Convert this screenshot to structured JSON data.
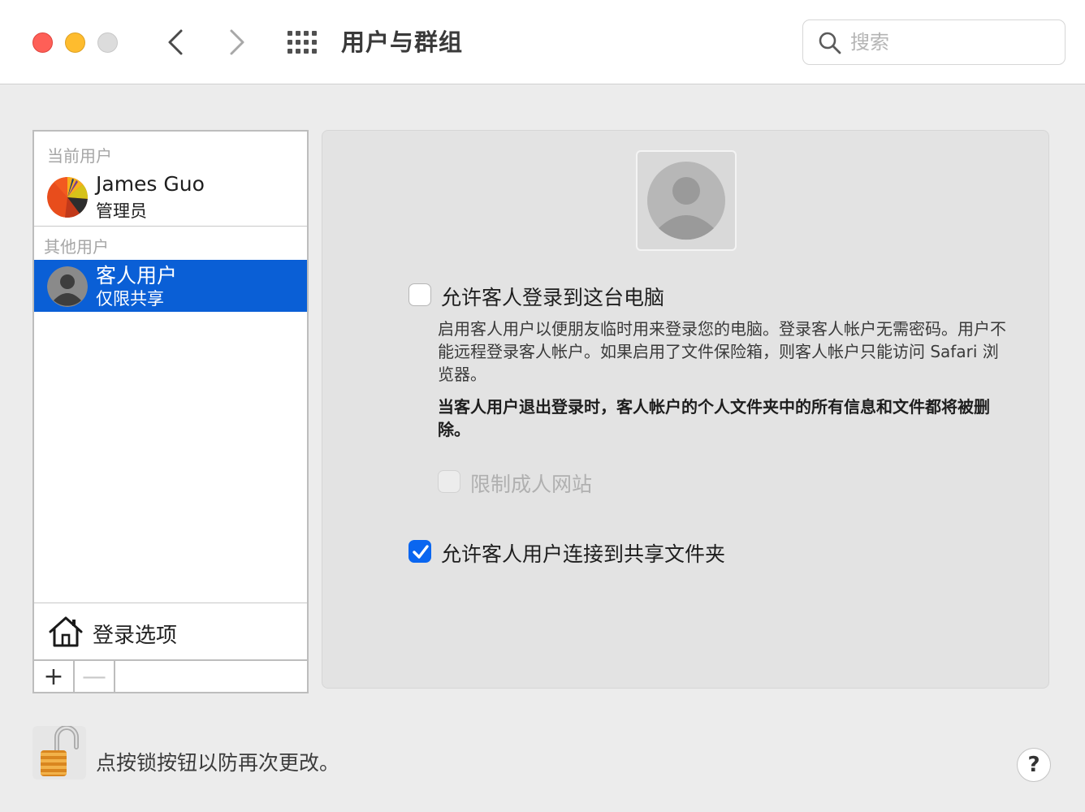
{
  "window": {
    "title": "用户与群组",
    "search_placeholder": "搜索"
  },
  "sidebar": {
    "current_section": "当前用户",
    "other_section": "其他用户",
    "current_user": {
      "name": "James Guo",
      "role": "管理员"
    },
    "other_users": [
      {
        "name": "客人用户",
        "role": "仅限共享",
        "selected": true
      }
    ],
    "login_options": "登录选项",
    "add_label": "+",
    "remove_label": "—"
  },
  "guest_panel": {
    "allow_login": {
      "label": "允许客人登录到这台电脑",
      "checked": false
    },
    "description": "启用客人用户以便朋友临时用来登录您的电脑。登录客人帐户无需密码。用户不能远程登录客人帐户。如果启用了文件保险箱，则客人帐户只能访问 Safari 浏览器。",
    "warning": "当客人用户退出登录时，客人帐户的个人文件夹中的所有信息和文件都将被删除。",
    "limit_adult": {
      "label": "限制成人网站",
      "checked": false,
      "enabled": false
    },
    "allow_shared": {
      "label": "允许客人用户连接到共享文件夹",
      "checked": true
    }
  },
  "footer": {
    "lock_text": "点按锁按钮以防再次更改。",
    "help_label": "?"
  },
  "colors": {
    "accent": "#0a5fd6",
    "close": "#fe5f57",
    "minimize": "#febc2e"
  }
}
